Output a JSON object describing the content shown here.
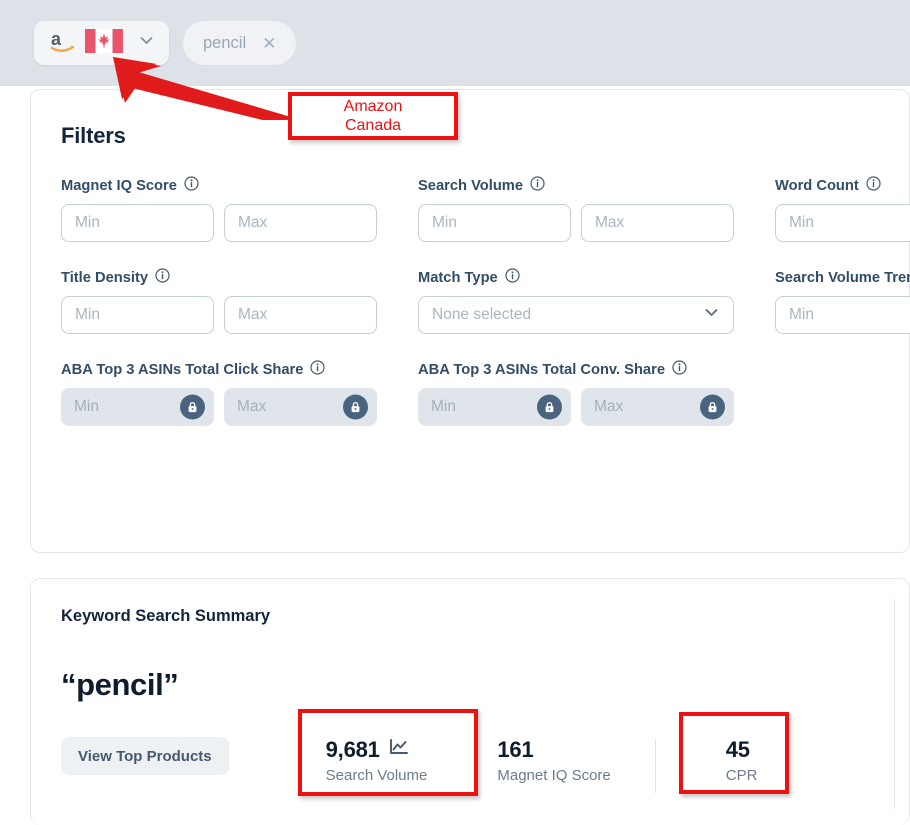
{
  "topbar": {
    "marketplace": {
      "name": "Amazon Canada",
      "amazon_icon": "amazon-logo-icon",
      "flag_icon": "canada-flag-icon",
      "chevron_icon": "chevron-down-icon"
    },
    "search_chip": {
      "text": "pencil",
      "clear_icon": "close-icon"
    }
  },
  "filters": {
    "title": "Filters",
    "info_icon": "info-icon",
    "lock_icon": "lock-icon",
    "placeholders": {
      "min": "Min",
      "max": "Max"
    },
    "rows": [
      {
        "columns": [
          {
            "label": "Magnet IQ Score",
            "type": "minmax",
            "min": "",
            "max": "",
            "locked": false
          },
          {
            "label": "Search Volume",
            "type": "minmax",
            "min": "",
            "max": "",
            "locked": false
          },
          {
            "label": "Word Count",
            "type": "minmax",
            "min": "",
            "max": "",
            "locked": false
          }
        ]
      },
      {
        "columns": [
          {
            "label": "Title Density",
            "type": "minmax",
            "min": "",
            "max": "",
            "locked": false
          },
          {
            "label": "Match Type",
            "type": "select",
            "value": "None selected",
            "chevron_icon": "chevron-down-icon"
          },
          {
            "label": "Search Volume Trend",
            "type": "minmax",
            "min": "",
            "max": "",
            "locked": false
          }
        ]
      },
      {
        "columns": [
          {
            "label": "ABA Top 3 ASINs Total Click Share",
            "type": "minmax",
            "min": "",
            "max": "",
            "locked": true
          },
          {
            "label": "ABA Top 3 ASINs Total Conv. Share",
            "type": "minmax",
            "min": "",
            "max": "",
            "locked": true
          }
        ]
      }
    ]
  },
  "summary": {
    "title": "Keyword Search Summary",
    "keyword": "“pencil”",
    "view_top_products_label": "View Top Products",
    "metrics": [
      {
        "value": "9,681",
        "label": "Search Volume",
        "icon": "line-chart-icon"
      },
      {
        "value": "161",
        "label": "Magnet IQ Score",
        "icon": ""
      },
      {
        "value": "45",
        "label": "CPR",
        "icon": ""
      }
    ]
  },
  "annotations": {
    "color": "#ee1111",
    "callout": {
      "line1": "Amazon",
      "line2": "Canada"
    },
    "arrow_icon": "red-arrow-icon",
    "highlight_search_volume": "Search Volume metric highlighted",
    "highlight_cpr": "CPR metric highlighted"
  }
}
